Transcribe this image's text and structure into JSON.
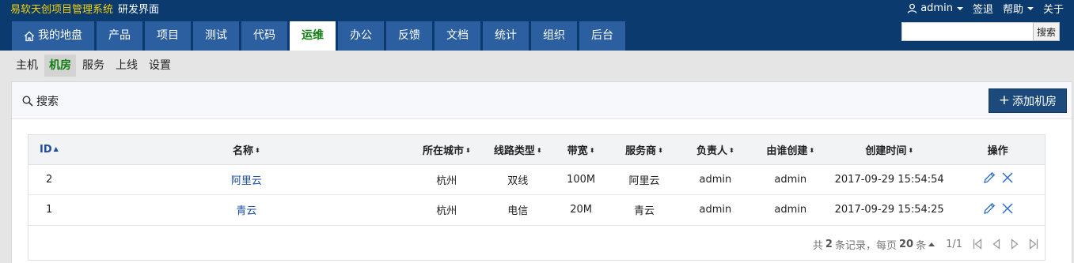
{
  "header": {
    "app_title": "易软天创项目管理系统",
    "app_subtitle": "研发界面",
    "user": "admin",
    "signout": "签退",
    "help": "帮助",
    "about": "关于",
    "search_placeholder": "",
    "search_button": "搜索"
  },
  "mainnav": {
    "items": [
      {
        "label": "我的地盘",
        "icon": "home-icon"
      },
      {
        "label": "产品"
      },
      {
        "label": "项目"
      },
      {
        "label": "测试"
      },
      {
        "label": "代码"
      },
      {
        "label": "运维",
        "active": true
      },
      {
        "label": "办公"
      },
      {
        "label": "反馈"
      },
      {
        "label": "文档"
      },
      {
        "label": "统计"
      },
      {
        "label": "组织"
      },
      {
        "label": "后台"
      }
    ]
  },
  "subnav": {
    "items": [
      {
        "label": "主机"
      },
      {
        "label": "机房",
        "active": true
      },
      {
        "label": "服务"
      },
      {
        "label": "上线"
      },
      {
        "label": "设置"
      }
    ]
  },
  "toolbar": {
    "search_label": "搜索",
    "add_label": "添加机房"
  },
  "table": {
    "headers": [
      "ID",
      "名称",
      "所在城市",
      "线路类型",
      "带宽",
      "服务商",
      "负责人",
      "由谁创建",
      "创建时间",
      "操作"
    ],
    "rows": [
      [
        "2",
        "阿里云",
        "杭州",
        "双线",
        "100M",
        "阿里云",
        "admin",
        "admin",
        "2017-09-29 15:54:54"
      ],
      [
        "1",
        "青云",
        "杭州",
        "电信",
        "20M",
        "青云",
        "admin",
        "admin",
        "2017-09-29 15:54:25"
      ]
    ]
  },
  "pager": {
    "prefix": "共",
    "total": "2",
    "records_text": "条记录，每页",
    "per_page": "20",
    "per_page_unit": "条",
    "page_info": "1/1"
  },
  "colors": {
    "header_bg": "#0a3a6e",
    "tab_bg": "#2b5fa0",
    "active_green": "#0f7c0f",
    "link_blue": "#1c4fa0",
    "brand_yellow": "#f5d20a",
    "button_bg": "#1c4a7c"
  }
}
